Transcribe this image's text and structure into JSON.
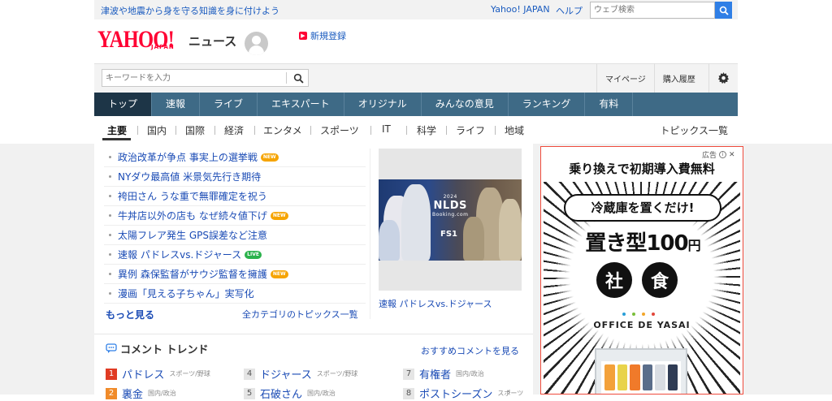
{
  "top": {
    "alert_link": "津波や地震から身を守る知識を身に付けよう",
    "yahoo_japan_link": "Yahoo! JAPAN",
    "help_link": "ヘルプ",
    "web_search_placeholder": "ウェブ検索"
  },
  "header": {
    "logo_text": "YAHOO!",
    "logo_sub": "JAPAN",
    "service_name": "ニュース",
    "register_label": "新規登録"
  },
  "search": {
    "placeholder": "キーワードを入力",
    "mypage": "マイページ",
    "history": "購入履歴"
  },
  "main_nav": [
    "トップ",
    "速報",
    "ライブ",
    "エキスパート",
    "オリジナル",
    "みんなの意見",
    "ランキング",
    "有料"
  ],
  "sub_nav": [
    "主要",
    "国内",
    "国際",
    "経済",
    "エンタメ",
    "スポーツ",
    "IT",
    "科学",
    "ライフ",
    "地域"
  ],
  "sub_nav_all": "トピックス一覧",
  "topics": [
    {
      "title": "政治改革が争点 事実上の選挙戦",
      "badge": "NEW"
    },
    {
      "title": "NYダウ最高値 米景気先行き期待",
      "badge": ""
    },
    {
      "title": "袴田さん うな重で無罪確定を祝う",
      "badge": ""
    },
    {
      "title": "牛丼店以外の店も なぜ続々値下げ",
      "badge": "NEW"
    },
    {
      "title": "太陽フレア発生 GPS誤差など注意",
      "badge": ""
    },
    {
      "title": "速報 パドレスvs.ドジャース",
      "badge": "LIVE"
    },
    {
      "title": "異例 森保監督がサウジ監督を擁護",
      "badge": "NEW"
    },
    {
      "title": "漫画「見える子ちゃん」実写化",
      "badge": ""
    }
  ],
  "more_link": "もっと見る",
  "all_categories_link": "全カテゴリのトピックス一覧",
  "photo": {
    "caption": "速報 パドレスvs.ドジャース",
    "nlds_year": "2024",
    "nlds": "NLDS",
    "sponsor": "Booking.com",
    "fs": "FS1"
  },
  "comment_trend": {
    "title": "コメント トレンド",
    "more": "おすすめコメントを見る",
    "items": [
      {
        "rank": "1",
        "word": "パドレス",
        "category": "スポーツ/野球"
      },
      {
        "rank": "4",
        "word": "ドジャース",
        "category": "スポーツ/野球"
      },
      {
        "rank": "7",
        "word": "有権者",
        "category": "国内/政治"
      },
      {
        "rank": "2",
        "word": "裏金",
        "category": "国内/政治"
      },
      {
        "rank": "5",
        "word": "石破さん",
        "category": "国内/政治"
      },
      {
        "rank": "8",
        "word": "ポストシーズン",
        "category": "スポーツ"
      }
    ]
  },
  "ad": {
    "label": "広告",
    "headline": "乗り換えで初期導入費無料",
    "pill": "冷蔵庫を置くだけ!",
    "big": "置き型100",
    "big_unit": "円",
    "circle1": "社",
    "circle2": "食",
    "brand": "OFFICE DE YASAI"
  },
  "colors": {
    "nav_bg": "#3e6a86",
    "nav_active": "#1d3547",
    "link": "#1a4bb5",
    "brand_red": "#ff0033",
    "search_btn": "#2f7fe6"
  }
}
